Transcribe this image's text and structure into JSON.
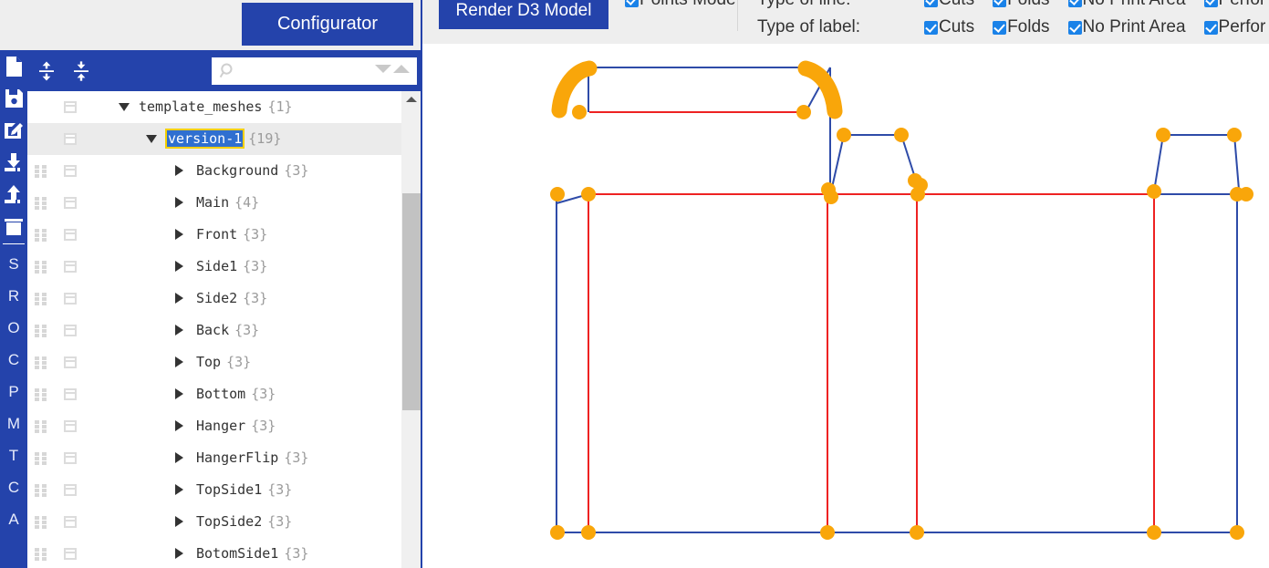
{
  "left_panel": {
    "tab": {
      "label": "Configurator"
    },
    "toolbar": {
      "expand_all_icon": "expand-all-icon",
      "collapse_all_icon": "collapse-all-icon",
      "search": {
        "value": "",
        "placeholder": ""
      },
      "search_icon": "search-icon",
      "next_match_icon": "chevron-down-icon",
      "prev_match_icon": "chevron-up-icon"
    },
    "scrollbar": {
      "up_arrow_icon": "scroll-up-arrow-icon"
    },
    "icon_rail": {
      "icons": [
        {
          "name": "new-file-icon"
        },
        {
          "name": "save-file-icon"
        },
        {
          "name": "edit-file-icon"
        },
        {
          "name": "download-icon"
        },
        {
          "name": "upload-icon"
        },
        {
          "name": "delete-icon"
        }
      ],
      "letters": [
        "S",
        "R",
        "O",
        "C",
        "P",
        "M",
        "T",
        "C",
        "A"
      ]
    },
    "tree": [
      {
        "label": "template_meshes",
        "count": "{1}",
        "depth": 0,
        "caret": "open",
        "selected": false,
        "handle": false
      },
      {
        "label": "version-1",
        "count": "{19}",
        "depth": 1,
        "caret": "open",
        "selected": true,
        "handle": false
      },
      {
        "label": "Background",
        "count": "{3}",
        "depth": 2,
        "caret": "closed",
        "selected": false,
        "handle": true
      },
      {
        "label": "Main",
        "count": "{4}",
        "depth": 2,
        "caret": "closed",
        "selected": false,
        "handle": true
      },
      {
        "label": "Front",
        "count": "{3}",
        "depth": 2,
        "caret": "closed",
        "selected": false,
        "handle": true
      },
      {
        "label": "Side1",
        "count": "{3}",
        "depth": 2,
        "caret": "closed",
        "selected": false,
        "handle": true
      },
      {
        "label": "Side2",
        "count": "{3}",
        "depth": 2,
        "caret": "closed",
        "selected": false,
        "handle": true
      },
      {
        "label": "Back",
        "count": "{3}",
        "depth": 2,
        "caret": "closed",
        "selected": false,
        "handle": true
      },
      {
        "label": "Top",
        "count": "{3}",
        "depth": 2,
        "caret": "closed",
        "selected": false,
        "handle": true
      },
      {
        "label": "Bottom",
        "count": "{3}",
        "depth": 2,
        "caret": "closed",
        "selected": false,
        "handle": true
      },
      {
        "label": "Hanger",
        "count": "{3}",
        "depth": 2,
        "caret": "closed",
        "selected": false,
        "handle": true
      },
      {
        "label": "HangerFlip",
        "count": "{3}",
        "depth": 2,
        "caret": "closed",
        "selected": false,
        "handle": true
      },
      {
        "label": "TopSide1",
        "count": "{3}",
        "depth": 2,
        "caret": "closed",
        "selected": false,
        "handle": true
      },
      {
        "label": "TopSide2",
        "count": "{3}",
        "depth": 2,
        "caret": "closed",
        "selected": false,
        "handle": true
      },
      {
        "label": "BotomSide1",
        "count": "{3}",
        "depth": 2,
        "caret": "closed",
        "selected": false,
        "handle": true
      }
    ]
  },
  "right_panel": {
    "render_button": {
      "label": "Render D3 Model"
    },
    "points_mode": {
      "label": "Points Mode",
      "checked": true
    },
    "type_of_line": {
      "label": "Type of line:",
      "options": [
        {
          "label": "Cuts",
          "checked": true
        },
        {
          "label": "Folds",
          "checked": true
        },
        {
          "label": "No Print Area",
          "checked": true
        },
        {
          "label": "Perfor",
          "checked": true
        }
      ]
    },
    "type_of_label": {
      "label": "Type of label:",
      "options": [
        {
          "label": "Cuts",
          "checked": true
        },
        {
          "label": "Folds",
          "checked": true
        },
        {
          "label": "No Print Area",
          "checked": true
        },
        {
          "label": "Perfor",
          "checked": true
        }
      ]
    },
    "canvas": {
      "colors": {
        "cut_line": "#2e4ba8",
        "fold_line": "#ee2222",
        "point": "#f9a60a"
      }
    }
  }
}
